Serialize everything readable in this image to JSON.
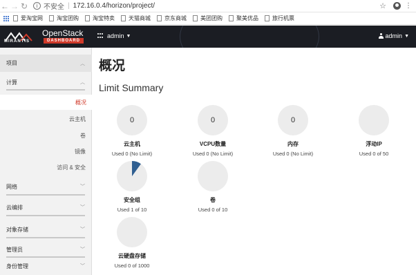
{
  "browser": {
    "insecure_label": "不安全",
    "url": "172.16.0.4/horizon/project/",
    "bookmarks": [
      "爱淘宝网",
      "淘宝团购",
      "淘宝特卖",
      "天猫商城",
      "京东商城",
      "美团团购",
      "聚美优品",
      "旅行机票"
    ]
  },
  "header": {
    "brand": "OpenStack",
    "brand_sub": "DASHBOARD",
    "vendor": "MIRANTIS",
    "project": "admin",
    "user": "admin"
  },
  "sidebar": {
    "items": [
      {
        "label": "项目",
        "type": "category",
        "chevron": "up"
      },
      {
        "label": "计算",
        "type": "category",
        "chevron": "up"
      },
      {
        "label": "概况",
        "type": "link",
        "active": true
      },
      {
        "label": "云主机",
        "type": "link"
      },
      {
        "label": "卷",
        "type": "link"
      },
      {
        "label": "镜像",
        "type": "link"
      },
      {
        "label": "访问 & 安全",
        "type": "link"
      },
      {
        "label": "网络",
        "type": "category",
        "chevron": "down"
      },
      {
        "label": "云编排",
        "type": "category",
        "chevron": "down"
      },
      {
        "label": "对象存储",
        "type": "category",
        "chevron": "down"
      },
      {
        "label": "管理员",
        "type": "category",
        "chevron": "down"
      },
      {
        "label": "身份管理",
        "type": "category",
        "chevron": "down"
      }
    ]
  },
  "main": {
    "title": "概况",
    "subtitle": "Limit Summary",
    "limits": [
      {
        "label": "云主机",
        "center": "0",
        "used": "Used 0 (No Limit)",
        "fraction": 0
      },
      {
        "label": "VCPU数量",
        "center": "0",
        "used": "Used 0 (No Limit)",
        "fraction": 0
      },
      {
        "label": "内存",
        "center": "0",
        "used": "Used 0 (No Limit)",
        "fraction": 0
      },
      {
        "label": "浮动IP",
        "center": "",
        "used": "Used 0 of 50",
        "fraction": 0
      },
      {
        "label": "安全组",
        "center": "",
        "used": "Used 1 of 10",
        "fraction": 0.1
      },
      {
        "label": "卷",
        "center": "",
        "used": "Used 0 of 10",
        "fraction": 0
      },
      {
        "label": "云硬盘存储",
        "center": "",
        "used": "Used 0 of 1000",
        "fraction": 0
      }
    ],
    "pie_fill_color": "#2f5f91"
  }
}
